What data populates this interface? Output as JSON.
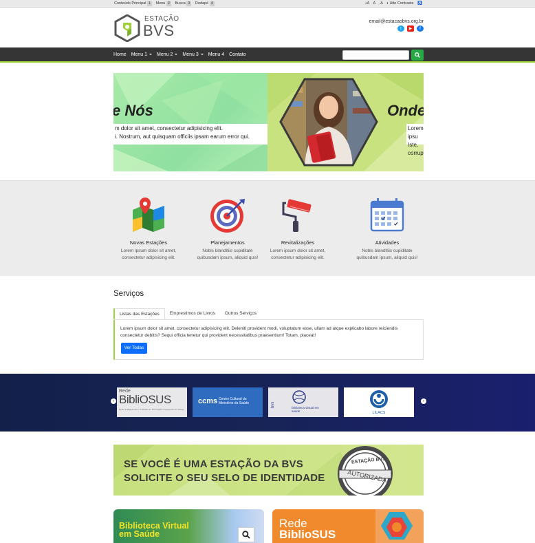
{
  "accessibility_bar": {
    "items": [
      {
        "label": "Conteúdo Principal",
        "key": "1"
      },
      {
        "label": "Menu",
        "key": "2"
      },
      {
        "label": "Busca",
        "key": "3"
      },
      {
        "label": "Rodapé",
        "key": "4"
      }
    ],
    "font_increase": "+A",
    "font_normal": "A",
    "font_decrease": "-A",
    "contrast": "Alto Contraste"
  },
  "header": {
    "logo_line1": "ESTAÇÃO",
    "logo_line2": "BVS",
    "email": "email@estacaobvs.org.br",
    "social_icons": [
      "twitter-icon",
      "youtube-icon",
      "facebook-icon"
    ]
  },
  "nav": {
    "items": [
      {
        "label": "Home",
        "dropdown": false
      },
      {
        "label": "Menu 1",
        "dropdown": true
      },
      {
        "label": "Menu 2",
        "dropdown": true
      },
      {
        "label": "Menu 3",
        "dropdown": true
      },
      {
        "label": "Menu 4",
        "dropdown": false
      },
      {
        "label": "Contato",
        "dropdown": false
      }
    ],
    "search_value": "",
    "accent_color": "#9fd13b"
  },
  "banner": {
    "left_title": "e Nós",
    "left_line1": "m dolor sit amet, consectetur adipisicing elit.",
    "left_line2": "i. Nostrum, aut quisquam officiis ipsam earum error qui.",
    "right_title": "Onde",
    "right_line1": "Lorem ipsu",
    "right_line2": "Iste, corrupt"
  },
  "features": [
    {
      "title": "Novas Estações",
      "desc1": "Lorem ipsum dolor sit amet,",
      "desc2": "consectetur adipisicing elit.",
      "icon": "map-pin-icon"
    },
    {
      "title": "Planejamentos",
      "desc1": "Nobis blanditiis cupiditate",
      "desc2": "quibusdam ipsum, aliquid quis!",
      "icon": "target-icon"
    },
    {
      "title": "Revitalizações",
      "desc1": "Lorem ipsum dolor sit amet,",
      "desc2": "consectetur adipisicing elit.",
      "icon": "paint-roller-icon"
    },
    {
      "title": "Atividades",
      "desc1": "Nobis blanditiis cupiditate",
      "desc2": "quibusdam ipsum, aliquid quis!",
      "icon": "calendar-icon"
    }
  ],
  "servicos": {
    "title": "Serviços",
    "tabs": [
      "Listas das Estações",
      "Emprestimos de Livros",
      "Outros Serviços"
    ],
    "active_tab": "Listas das Estações",
    "content": "Lorem ipsum dolor sit amet, consectetur adipisicing elit. Deleniti provident modi, voluptatum esse, ullam ad atque explicabo labore reiciendis consectetur debitis? Sequi officia tenetur qui provident necessitatibus praesentium! Totam, placeat!",
    "button": "Ver Todas"
  },
  "partners": {
    "logos": [
      {
        "line1": "Rede",
        "line2": "BibliOSUS",
        "sub": "Rede de Bibliotecas e Unidades de Informação Cooperantes da Saúde"
      },
      {
        "line1": "ccms",
        "line2": "Centro Cultural do Ministério da Saúde"
      },
      {
        "line1": "bvs",
        "line2": "biblioteca virtual em saúde"
      },
      {
        "line1": "LILACS"
      }
    ]
  },
  "selo": {
    "line1": "SE VOCÊ É UMA ESTAÇÃO DA BVS",
    "line2": "SOLICITE O SEU SELO DE IDENTIDADE",
    "badge_top": "ESTAÇÃO BVS",
    "badge_bottom": "AUTORIZADA"
  },
  "cards": [
    {
      "line1": "Biblioteca Virtual",
      "line2": "em Saúde"
    },
    {
      "line1": "Rede",
      "line2": "BiblioSUS"
    }
  ]
}
